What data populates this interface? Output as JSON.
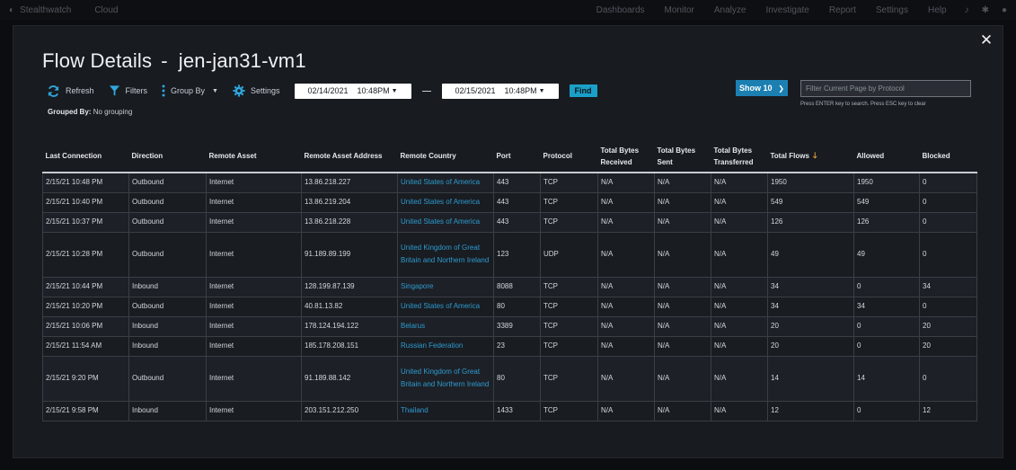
{
  "topbar": {
    "brand": "Stealthwatch",
    "product": "Cloud",
    "nav": [
      "Dashboards",
      "Monitor",
      "Analyze",
      "Investigate",
      "Report",
      "Settings",
      "Help"
    ]
  },
  "modal": {
    "title_prefix": "Flow Details",
    "title_sep": "-",
    "title_asset": "jen-jan31-vm1",
    "toolbar": {
      "refresh": "Refresh",
      "filters": "Filters",
      "group_by": "Group By",
      "settings": "Settings",
      "date_from": "02/14/2021",
      "time_from": "10:48PM",
      "date_to": "02/15/2021",
      "time_to": "10:48PM",
      "find": "Find"
    },
    "show": "Show 10",
    "filter_placeholder": "Filter Current Page by Protocol",
    "filter_hint": "Press ENTER key to search. Press ESC key to clear",
    "grouped_by_label": "Grouped By:",
    "grouped_by_value": "No grouping"
  },
  "table": {
    "headers": [
      "Last Connection",
      "Direction",
      "Remote Asset",
      "Remote Asset Address",
      "Remote Country",
      "Port",
      "Protocol",
      "Total Bytes Received",
      "Total Bytes Sent",
      "Total Bytes Transferred",
      "Total Flows",
      "Allowed",
      "Blocked"
    ],
    "rows": [
      [
        "2/15/21 10:48 PM",
        "Outbound",
        "Internet",
        "13.86.218.227",
        "United States of America",
        "443",
        "TCP",
        "N/A",
        "N/A",
        "N/A",
        "1950",
        "1950",
        "0"
      ],
      [
        "2/15/21 10:40 PM",
        "Outbound",
        "Internet",
        "13.86.219.204",
        "United States of America",
        "443",
        "TCP",
        "N/A",
        "N/A",
        "N/A",
        "549",
        "549",
        "0"
      ],
      [
        "2/15/21 10:37 PM",
        "Outbound",
        "Internet",
        "13.86.218.228",
        "United States of America",
        "443",
        "TCP",
        "N/A",
        "N/A",
        "N/A",
        "126",
        "126",
        "0"
      ],
      [
        "2/15/21 10:28 PM",
        "Outbound",
        "Internet",
        "91.189.89.199",
        "United Kingdom of Great Britain and Northern Ireland",
        "123",
        "UDP",
        "N/A",
        "N/A",
        "N/A",
        "49",
        "49",
        "0"
      ],
      [
        "2/15/21 10:44 PM",
        "Inbound",
        "Internet",
        "128.199.87.139",
        "Singapore",
        "8088",
        "TCP",
        "N/A",
        "N/A",
        "N/A",
        "34",
        "0",
        "34"
      ],
      [
        "2/15/21 10:20 PM",
        "Outbound",
        "Internet",
        "40.81.13.82",
        "United States of America",
        "80",
        "TCP",
        "N/A",
        "N/A",
        "N/A",
        "34",
        "34",
        "0"
      ],
      [
        "2/15/21 10:06 PM",
        "Inbound",
        "Internet",
        "178.124.194.122",
        "Belarus",
        "3389",
        "TCP",
        "N/A",
        "N/A",
        "N/A",
        "20",
        "0",
        "20"
      ],
      [
        "2/15/21 11:54 AM",
        "Inbound",
        "Internet",
        "185.178.208.151",
        "Russian Federation",
        "23",
        "TCP",
        "N/A",
        "N/A",
        "N/A",
        "20",
        "0",
        "20"
      ],
      [
        "2/15/21 9:20 PM",
        "Outbound",
        "Internet",
        "91.189.88.142",
        "United Kingdom of Great Britain and Northern Ireland",
        "80",
        "TCP",
        "N/A",
        "N/A",
        "N/A",
        "14",
        "14",
        "0"
      ],
      [
        "2/15/21 9:58 PM",
        "Inbound",
        "Internet",
        "203.151.212.250",
        "Thailand",
        "1433",
        "TCP",
        "N/A",
        "N/A",
        "N/A",
        "12",
        "0",
        "12"
      ]
    ]
  },
  "colors": {
    "accent": "#1aa0c8",
    "link": "#2e9bd0",
    "sort_arrow": "#f0a43a",
    "select_bg": "#1c7fb2"
  }
}
